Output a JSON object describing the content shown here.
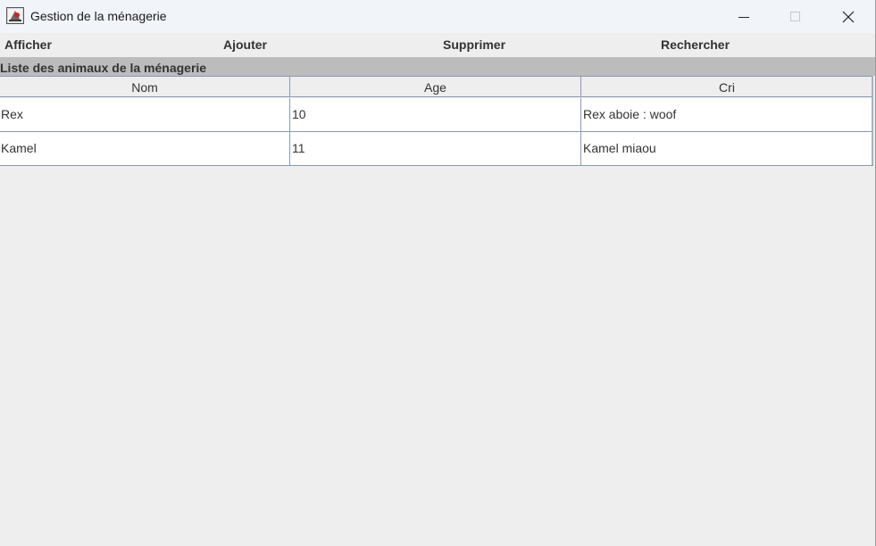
{
  "window": {
    "title": "Gestion de la ménagerie",
    "icons": {
      "app": "java-app-icon",
      "minimize": "minimize-icon",
      "maximize": "maximize-icon",
      "close": "close-icon"
    }
  },
  "menu": {
    "items": [
      {
        "label": "Afficher"
      },
      {
        "label": "Ajouter"
      },
      {
        "label": "Supprimer"
      },
      {
        "label": "Rechercher"
      }
    ]
  },
  "section": {
    "title": "Liste des animaux de la ménagerie"
  },
  "table": {
    "columns": [
      "Nom",
      "Age",
      "Cri"
    ],
    "rows": [
      [
        "Rex",
        "10",
        "Rex aboie : woof"
      ],
      [
        "Kamel",
        "11",
        "Kamel miaou"
      ]
    ]
  },
  "colors": {
    "background": "#eeeeee",
    "titlebar": "#f1f4f9",
    "section_header": "#bcbcbc",
    "grid_lines": "#8a99b3"
  }
}
